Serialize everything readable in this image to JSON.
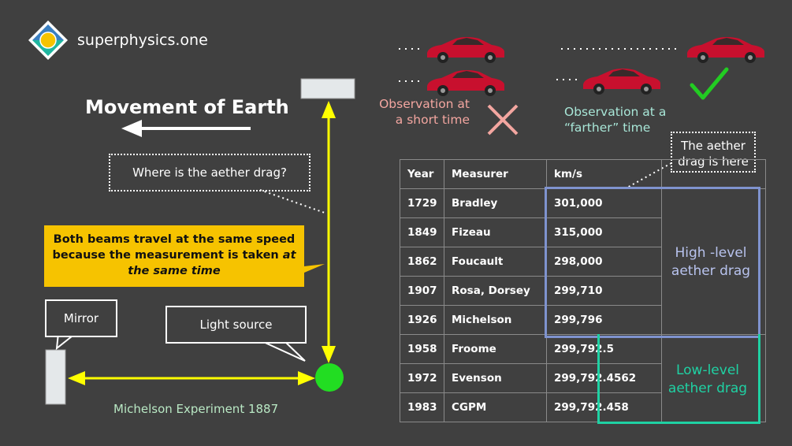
{
  "logo": {
    "text": "superphysics.one"
  },
  "diagram": {
    "title": "Movement of Earth",
    "question": "Where is the aether drag?",
    "callout_lines": [
      "Both beams travel at the same speed",
      "because the measurement is taken "
    ],
    "callout_em": "at",
    "callout_line3": "the same time",
    "mirror_label": "Mirror",
    "light_source_label": "Light source",
    "caption": "Michelson Experiment 1887"
  },
  "observations": {
    "short": "Observation at a short time",
    "far": "Observation at a “farther” time",
    "note": "The aether drag is here"
  },
  "table": {
    "headers": [
      "Year",
      "Measurer",
      "km/s"
    ],
    "rows": [
      [
        "1729",
        "Bradley",
        "301,000"
      ],
      [
        "1849",
        "Fizeau",
        "315,000"
      ],
      [
        "1862",
        "Foucault",
        "298,000"
      ],
      [
        "1907",
        "Rosa, Dorsey",
        "299,710"
      ],
      [
        "1926",
        "Michelson",
        "299,796"
      ],
      [
        "1958",
        "Froome",
        "299,792.5"
      ],
      [
        "1972",
        "Evenson",
        "299,792.4562"
      ],
      [
        "1983",
        "CGPM",
        "299,792.458"
      ]
    ],
    "high_label": "High -level aether drag",
    "low_label": "Low-level aether drag"
  },
  "colors": {
    "background": "#404040",
    "beam": "#ffff00",
    "callout": "#f6c300",
    "light_source": "#22dd22",
    "high_box": "#7f93cf",
    "low_box": "#1fd1a3",
    "cross": "#f3a6a0",
    "check": "#22cc22",
    "car": "#c8102e"
  }
}
